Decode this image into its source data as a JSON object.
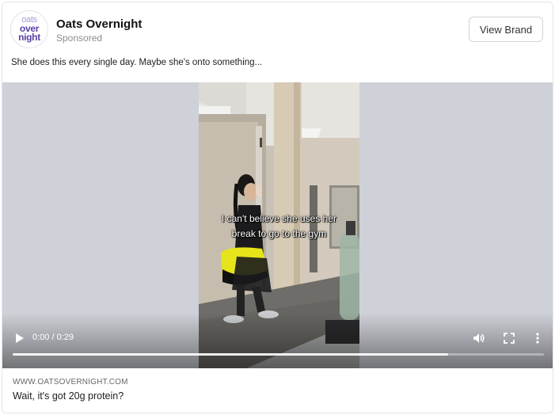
{
  "brand": {
    "logo_line1": "oats",
    "logo_line2": "over",
    "logo_line3": "night",
    "name": "Oats Overnight",
    "sponsored_label": "Sponsored",
    "view_brand_label": "View Brand"
  },
  "post": {
    "caption": "She does this every single day. Maybe she's onto something..."
  },
  "video": {
    "subtitle_line1": "I can't believe she uses her",
    "subtitle_line2": "break to go to the gym",
    "time_display": "0:00 / 0:29",
    "buffered_fraction": 0.82,
    "icons": {
      "play": "play-icon",
      "volume": "volume-icon",
      "fullscreen": "fullscreen-icon",
      "more": "more-vertical-icon"
    }
  },
  "footer": {
    "url": "WWW.OATSOVERNIGHT.COM",
    "headline": "Wait, it's got 20g protein?"
  },
  "colors": {
    "logo_purple": "#5b3fa8",
    "logo_light_purple": "#a99bd6",
    "video_letterbox": "#cfd1d8",
    "bag_yellow": "#e6e41a"
  }
}
